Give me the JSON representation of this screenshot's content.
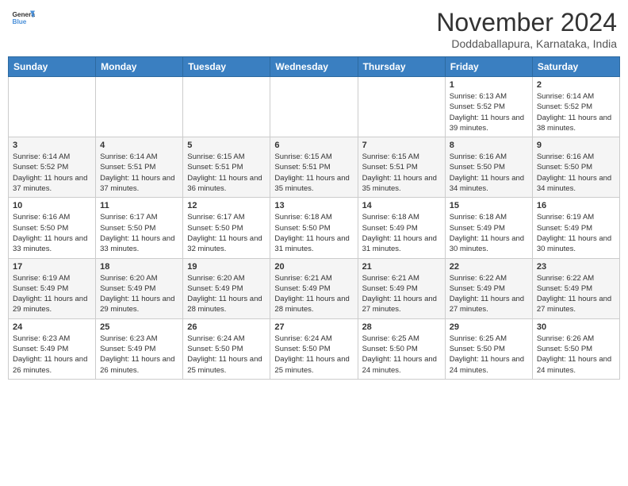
{
  "header": {
    "logo_line1": "General",
    "logo_line2": "Blue",
    "month": "November 2024",
    "location": "Doddaballapura, Karnataka, India"
  },
  "weekdays": [
    "Sunday",
    "Monday",
    "Tuesday",
    "Wednesday",
    "Thursday",
    "Friday",
    "Saturday"
  ],
  "weeks": [
    [
      {
        "day": "",
        "info": ""
      },
      {
        "day": "",
        "info": ""
      },
      {
        "day": "",
        "info": ""
      },
      {
        "day": "",
        "info": ""
      },
      {
        "day": "",
        "info": ""
      },
      {
        "day": "1",
        "info": "Sunrise: 6:13 AM\nSunset: 5:52 PM\nDaylight: 11 hours and 39 minutes."
      },
      {
        "day": "2",
        "info": "Sunrise: 6:14 AM\nSunset: 5:52 PM\nDaylight: 11 hours and 38 minutes."
      }
    ],
    [
      {
        "day": "3",
        "info": "Sunrise: 6:14 AM\nSunset: 5:52 PM\nDaylight: 11 hours and 37 minutes."
      },
      {
        "day": "4",
        "info": "Sunrise: 6:14 AM\nSunset: 5:51 PM\nDaylight: 11 hours and 37 minutes."
      },
      {
        "day": "5",
        "info": "Sunrise: 6:15 AM\nSunset: 5:51 PM\nDaylight: 11 hours and 36 minutes."
      },
      {
        "day": "6",
        "info": "Sunrise: 6:15 AM\nSunset: 5:51 PM\nDaylight: 11 hours and 35 minutes."
      },
      {
        "day": "7",
        "info": "Sunrise: 6:15 AM\nSunset: 5:51 PM\nDaylight: 11 hours and 35 minutes."
      },
      {
        "day": "8",
        "info": "Sunrise: 6:16 AM\nSunset: 5:50 PM\nDaylight: 11 hours and 34 minutes."
      },
      {
        "day": "9",
        "info": "Sunrise: 6:16 AM\nSunset: 5:50 PM\nDaylight: 11 hours and 34 minutes."
      }
    ],
    [
      {
        "day": "10",
        "info": "Sunrise: 6:16 AM\nSunset: 5:50 PM\nDaylight: 11 hours and 33 minutes."
      },
      {
        "day": "11",
        "info": "Sunrise: 6:17 AM\nSunset: 5:50 PM\nDaylight: 11 hours and 33 minutes."
      },
      {
        "day": "12",
        "info": "Sunrise: 6:17 AM\nSunset: 5:50 PM\nDaylight: 11 hours and 32 minutes."
      },
      {
        "day": "13",
        "info": "Sunrise: 6:18 AM\nSunset: 5:50 PM\nDaylight: 11 hours and 31 minutes."
      },
      {
        "day": "14",
        "info": "Sunrise: 6:18 AM\nSunset: 5:49 PM\nDaylight: 11 hours and 31 minutes."
      },
      {
        "day": "15",
        "info": "Sunrise: 6:18 AM\nSunset: 5:49 PM\nDaylight: 11 hours and 30 minutes."
      },
      {
        "day": "16",
        "info": "Sunrise: 6:19 AM\nSunset: 5:49 PM\nDaylight: 11 hours and 30 minutes."
      }
    ],
    [
      {
        "day": "17",
        "info": "Sunrise: 6:19 AM\nSunset: 5:49 PM\nDaylight: 11 hours and 29 minutes."
      },
      {
        "day": "18",
        "info": "Sunrise: 6:20 AM\nSunset: 5:49 PM\nDaylight: 11 hours and 29 minutes."
      },
      {
        "day": "19",
        "info": "Sunrise: 6:20 AM\nSunset: 5:49 PM\nDaylight: 11 hours and 28 minutes."
      },
      {
        "day": "20",
        "info": "Sunrise: 6:21 AM\nSunset: 5:49 PM\nDaylight: 11 hours and 28 minutes."
      },
      {
        "day": "21",
        "info": "Sunrise: 6:21 AM\nSunset: 5:49 PM\nDaylight: 11 hours and 27 minutes."
      },
      {
        "day": "22",
        "info": "Sunrise: 6:22 AM\nSunset: 5:49 PM\nDaylight: 11 hours and 27 minutes."
      },
      {
        "day": "23",
        "info": "Sunrise: 6:22 AM\nSunset: 5:49 PM\nDaylight: 11 hours and 27 minutes."
      }
    ],
    [
      {
        "day": "24",
        "info": "Sunrise: 6:23 AM\nSunset: 5:49 PM\nDaylight: 11 hours and 26 minutes."
      },
      {
        "day": "25",
        "info": "Sunrise: 6:23 AM\nSunset: 5:49 PM\nDaylight: 11 hours and 26 minutes."
      },
      {
        "day": "26",
        "info": "Sunrise: 6:24 AM\nSunset: 5:50 PM\nDaylight: 11 hours and 25 minutes."
      },
      {
        "day": "27",
        "info": "Sunrise: 6:24 AM\nSunset: 5:50 PM\nDaylight: 11 hours and 25 minutes."
      },
      {
        "day": "28",
        "info": "Sunrise: 6:25 AM\nSunset: 5:50 PM\nDaylight: 11 hours and 24 minutes."
      },
      {
        "day": "29",
        "info": "Sunrise: 6:25 AM\nSunset: 5:50 PM\nDaylight: 11 hours and 24 minutes."
      },
      {
        "day": "30",
        "info": "Sunrise: 6:26 AM\nSunset: 5:50 PM\nDaylight: 11 hours and 24 minutes."
      }
    ]
  ]
}
